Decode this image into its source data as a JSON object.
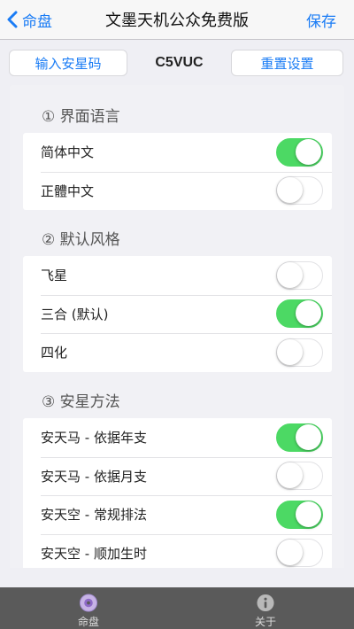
{
  "nav": {
    "back_label": "命盘",
    "title": "文墨天机公众免费版",
    "save_label": "保存"
  },
  "actions": {
    "input_label": "输入安星码",
    "code": "C5VUC",
    "reset_label": "重置设置"
  },
  "sections": [
    {
      "header": "① 界面语言",
      "rows": [
        {
          "label": "简体中文",
          "on": true
        },
        {
          "label": "正體中文",
          "on": false
        }
      ]
    },
    {
      "header": "② 默认风格",
      "rows": [
        {
          "label": "飞星",
          "on": false
        },
        {
          "label": "三合 (默认)",
          "on": true
        },
        {
          "label": "四化",
          "on": false
        }
      ]
    },
    {
      "header": "③ 安星方法",
      "rows": [
        {
          "label": "安天马 - 依据年支",
          "on": true
        },
        {
          "label": "安天马 - 依据月支",
          "on": false
        },
        {
          "label": "安天空 - 常规排法",
          "on": true
        },
        {
          "label": "安天空 - 顺加生时",
          "on": false
        }
      ]
    }
  ],
  "tabbar": {
    "tabs": [
      {
        "label": "命盘",
        "icon": "disc-icon"
      },
      {
        "label": "关于",
        "icon": "info-icon"
      }
    ]
  },
  "colors": {
    "accent": "#1a7cf5",
    "toggle_on": "#4cd964"
  }
}
